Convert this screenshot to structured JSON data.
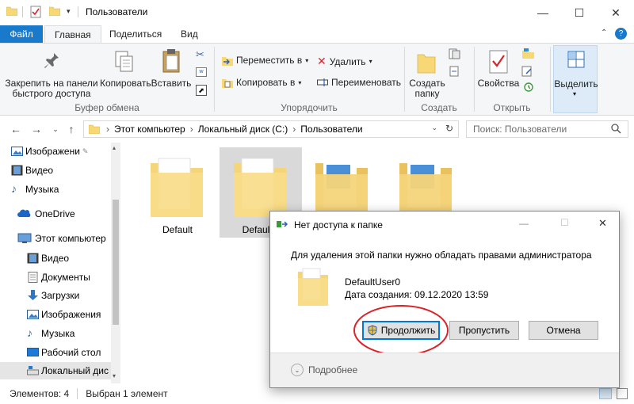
{
  "window": {
    "title": "Пользователи",
    "minimize": "—",
    "maximize": "☐",
    "close": "✕"
  },
  "tabs": [
    {
      "label": "Файл"
    },
    {
      "label": "Главная"
    },
    {
      "label": "Поделиться"
    },
    {
      "label": "Вид"
    }
  ],
  "ribbon": {
    "clipboard": {
      "pin": "Закрепить на панели быстрого доступа",
      "copy": "Копировать",
      "paste": "Вставить",
      "group": "Буфер обмена"
    },
    "organize": {
      "move": "Переместить в",
      "copy_to": "Копировать в",
      "delete": "Удалить",
      "rename": "Переименовать",
      "group": "Упорядочить"
    },
    "new": {
      "new_folder": "Создать папку",
      "group": "Создать"
    },
    "open": {
      "properties": "Свойства",
      "group": "Открыть"
    },
    "select": {
      "select": "Выделить"
    }
  },
  "address": {
    "crumbs": [
      "Этот компьютер",
      "Локальный диск (C:)",
      "Пользователи"
    ],
    "search_placeholder": "Поиск: Пользователи"
  },
  "nav": [
    {
      "label": "Изображени",
      "icon": "pictures-icon"
    },
    {
      "label": "Видео",
      "icon": "video-icon"
    },
    {
      "label": "Музыка",
      "icon": "music-icon"
    },
    {
      "label": "OneDrive",
      "icon": "onedrive-icon"
    },
    {
      "label": "Этот компьютер",
      "icon": "computer-icon"
    },
    {
      "label": "Видео",
      "icon": "video-icon"
    },
    {
      "label": "Документы",
      "icon": "documents-icon"
    },
    {
      "label": "Загрузки",
      "icon": "downloads-icon"
    },
    {
      "label": "Изображения",
      "icon": "pictures-icon"
    },
    {
      "label": "Музыка",
      "icon": "music-icon"
    },
    {
      "label": "Рабочий стол",
      "icon": "desktop-icon"
    },
    {
      "label": "Локальный дис",
      "icon": "drive-icon"
    }
  ],
  "files": [
    {
      "label": "Default"
    },
    {
      "label": "DefaultU"
    },
    {
      "label": ""
    },
    {
      "label": ""
    }
  ],
  "status": {
    "count": "Элементов: 4",
    "selected": "Выбран 1 элемент"
  },
  "dialog": {
    "title": "Нет доступа к папке",
    "message": "Для удаления этой папки нужно обладать правами администратора",
    "item_name": "DefaultUser0",
    "item_date": "Дата создания: 09.12.2020 13:59",
    "continue": "Продолжить",
    "skip": "Пропустить",
    "cancel": "Отмена",
    "more": "Подробнее"
  },
  "colors": {
    "accent": "#1979ca",
    "folder": "#f8d775",
    "highlight_circle": "#d9252a"
  }
}
